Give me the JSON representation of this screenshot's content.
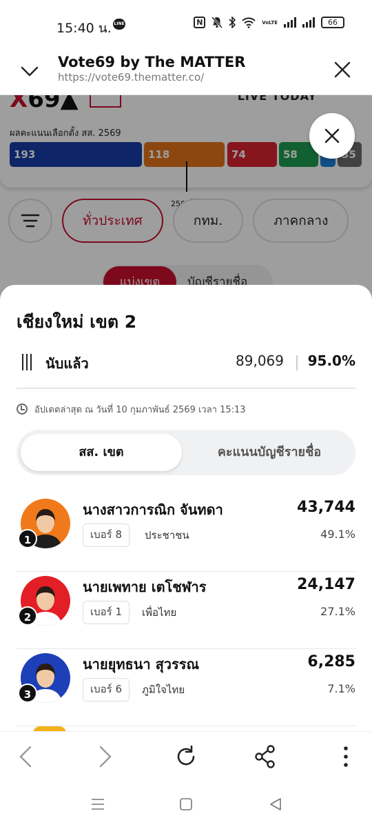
{
  "status_bar": {
    "time": "15:40 น.",
    "line_badge": "LINE",
    "nfc": "N",
    "volte": "VoLTE",
    "battery": "66"
  },
  "tab_header": {
    "title": "Vote69 by The MATTER",
    "url": "https://vote69.thematter.co/"
  },
  "background": {
    "logo_prefix": "X",
    "logo_text": "69",
    "header_right": "LIVE TODAY",
    "seat_title": "ผลคะแนนเลือกตั้ง สส. 2569",
    "seat_majority_label": "250 ที่นั่ง",
    "filter_chips": [
      "ทั่วประเทศ",
      "กทม.",
      "ภาคกลาง"
    ],
    "segment": {
      "active": "แบ่งเขต",
      "other": "บัญชีรายชื่อ"
    }
  },
  "seat_bars": [
    {
      "value": "193",
      "color": "#173ea6"
    },
    {
      "value": "118",
      "color": "#e2731b"
    },
    {
      "value": "74",
      "color": "#d8232f"
    },
    {
      "value": "58",
      "color": "#1e9b4f"
    },
    {
      "value": "",
      "color": "#1c7fd6"
    },
    {
      "value": "35",
      "color": "#6b6b6b"
    }
  ],
  "sheet": {
    "district_title": "เชียงใหม่ เขต 2",
    "counted_label": "นับแล้ว",
    "counted_votes": "89,069",
    "counted_percent": "95.0%",
    "updated_text": "อัปเดตล่าสุด ณ วันที่ 10 กุมภาพันธ์ 2569 เวลา 15:13",
    "tabs": {
      "active": "สส. เขต",
      "other": "คะแนนบัญชีรายชื่อ"
    },
    "candidates": [
      {
        "rank": "1",
        "name": "นางสาวการณิก จันทดา",
        "number": "เบอร์ 8",
        "party": "ประชาชน",
        "votes": "43,744",
        "percent": "49.1%",
        "party_color": "#f07a1b"
      },
      {
        "rank": "2",
        "name": "นายเพทาย เตโชฬาร",
        "number": "เบอร์ 1",
        "party": "เพื่อไทย",
        "votes": "24,147",
        "percent": "27.1%",
        "party_color": "#e41e26"
      },
      {
        "rank": "3",
        "name": "นายยุทธนา สุวรรณ",
        "number": "เบอร์ 6",
        "party": "ภูมิใจไทย",
        "votes": "6,285",
        "percent": "7.1%",
        "party_color": "#1d3fb8"
      }
    ]
  }
}
